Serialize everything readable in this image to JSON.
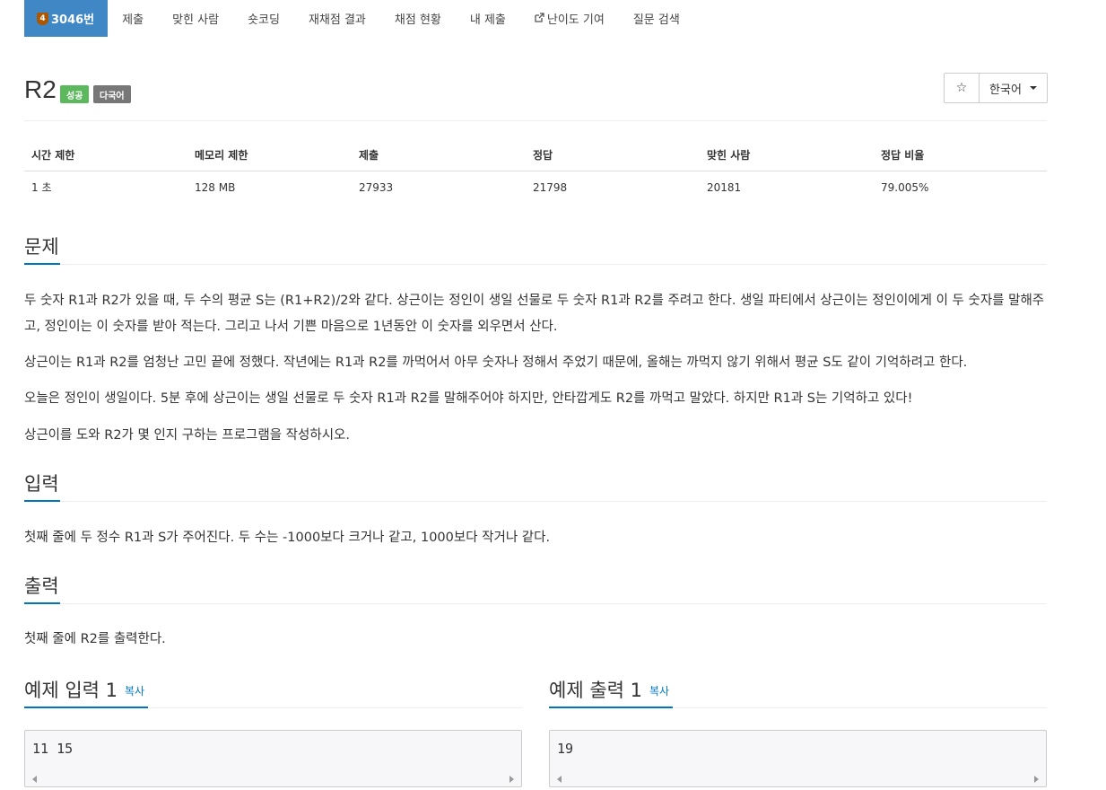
{
  "tabs": {
    "problem": {
      "tier": "4",
      "label": "3046번"
    },
    "submit": "제출",
    "solved_users": "맞힌 사람",
    "short_coding": "숏코딩",
    "rejudge": "재채점 결과",
    "status": "채점 현황",
    "my_submissions": "내 제출",
    "difficulty": "난이도 기여",
    "questions": "질문 검색"
  },
  "problem": {
    "title": "R2",
    "badges": {
      "solved": "성공",
      "multilang": "다국어"
    },
    "language": "한국어"
  },
  "info_table": {
    "headers": [
      "시간 제한",
      "메모리 제한",
      "제출",
      "정답",
      "맞힌 사람",
      "정답 비율"
    ],
    "values": [
      "1 초",
      "128 MB",
      "27933",
      "21798",
      "20181",
      "79.005%"
    ]
  },
  "sections": {
    "description": {
      "heading": "문제",
      "paragraphs": [
        "두 숫자 R1과 R2가 있을 때, 두 수의 평균 S는 (R1+R2)/2와 같다. 상근이는 정인이 생일 선물로 두 숫자 R1과 R2를 주려고 한다. 생일 파티에서 상근이는 정인이에게 이 두 숫자를 말해주고, 정인이는 이 숫자를 받아 적는다. 그리고 나서 기쁜 마음으로 1년동안 이 숫자를 외우면서 산다.",
        "상근이는 R1과 R2를 엄청난 고민 끝에 정했다. 작년에는 R1과 R2를 까먹어서 아무 숫자나 정해서 주었기 때문에, 올해는 까먹지 않기 위해서 평균 S도 같이 기억하려고 한다.",
        "오늘은 정인이 생일이다. 5분 후에 상근이는 생일 선물로 두 숫자 R1과 R2를 말해주어야 하지만, 안타깝게도 R2를 까먹고 말았다. 하지만 R1과 S는 기억하고 있다!",
        "상근이를 도와 R2가 몇 인지 구하는 프로그램을 작성하시오."
      ]
    },
    "input": {
      "heading": "입력",
      "text": "첫째 줄에 두 정수 R1과 S가 주어진다. 두 수는 -1000보다 크거나 같고, 1000보다 작거나 같다."
    },
    "output": {
      "heading": "출력",
      "text": "첫째 줄에 R2를 출력한다."
    },
    "sample_input": {
      "heading": "예제 입력 1",
      "copy": "복사",
      "content": "11 15"
    },
    "sample_output": {
      "heading": "예제 출력 1",
      "copy": "복사",
      "content": "19"
    }
  },
  "colors": {
    "active_tab": "#3f88c5",
    "tier_bronze": "#ad5600",
    "success_badge": "#5cb85c",
    "link": "#0076c0"
  }
}
